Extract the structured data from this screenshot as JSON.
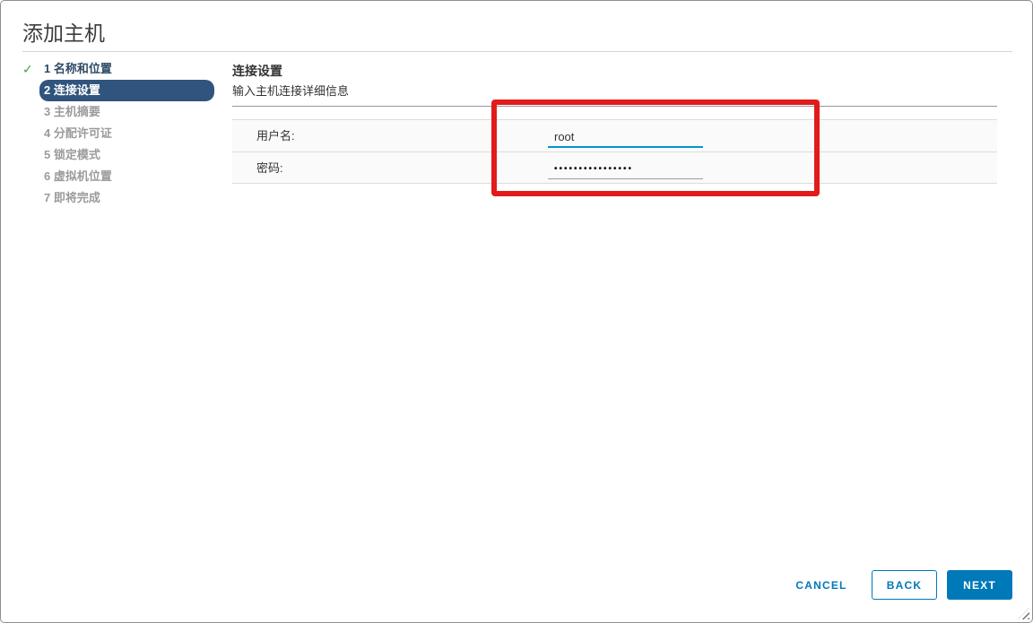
{
  "dialog": {
    "title": "添加主机"
  },
  "steps": [
    {
      "num": "1",
      "label": "名称和位置",
      "state": "completed"
    },
    {
      "num": "2",
      "label": "连接设置",
      "state": "active"
    },
    {
      "num": "3",
      "label": "主机摘要",
      "state": "pending"
    },
    {
      "num": "4",
      "label": "分配许可证",
      "state": "pending"
    },
    {
      "num": "5",
      "label": "锁定模式",
      "state": "pending"
    },
    {
      "num": "6",
      "label": "虚拟机位置",
      "state": "pending"
    },
    {
      "num": "7",
      "label": "即将完成",
      "state": "pending"
    }
  ],
  "icons": {
    "completed_check": "✓"
  },
  "content": {
    "heading": "连接设置",
    "subtitle": "输入主机连接详细信息",
    "fields": [
      {
        "label": "用户名:",
        "value": "root",
        "focused": true
      },
      {
        "label": "密码:",
        "value": "••••••••••••••••",
        "masked": true
      }
    ]
  },
  "footer": {
    "cancel": "CANCEL",
    "back": "BACK",
    "next": "NEXT"
  },
  "colors": {
    "primary_blue": "#0079b8",
    "focus_underline_blue": "#0095d3",
    "active_step_bg": "#30547e",
    "completed_step_text": "#2e4a66",
    "pending_step_text": "#9b9b9b",
    "success_green": "#42a33c",
    "annotation_red": "#e11b1b"
  }
}
